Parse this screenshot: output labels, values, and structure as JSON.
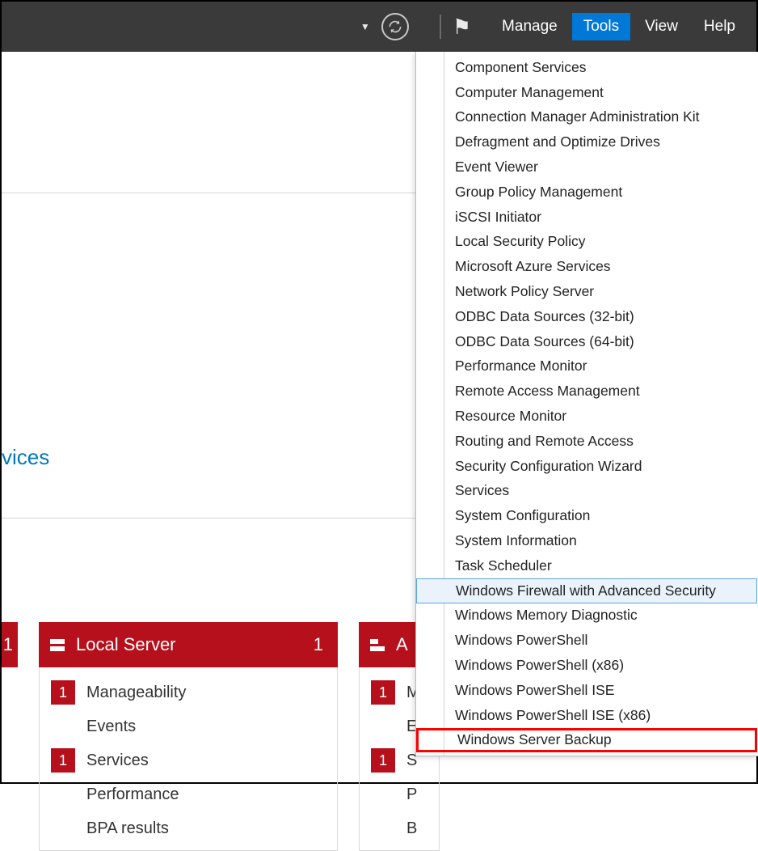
{
  "topbar": {
    "manage": "Manage",
    "tools": "Tools",
    "view": "View",
    "help": "Help"
  },
  "partial_link": "vices",
  "tile0": {
    "count": "1"
  },
  "tile1": {
    "title": "Local Server",
    "count": "1",
    "rows": [
      {
        "badge": "1",
        "label": "Manageability"
      },
      {
        "badge": "",
        "label": "Events"
      },
      {
        "badge": "1",
        "label": "Services"
      },
      {
        "badge": "",
        "label": "Performance"
      },
      {
        "badge": "",
        "label": "BPA results"
      }
    ]
  },
  "tile2": {
    "title_fragment": "A",
    "rows": [
      {
        "badge": "1",
        "label": "M"
      },
      {
        "badge": "",
        "label": "E"
      },
      {
        "badge": "1",
        "label": "S"
      },
      {
        "badge": "",
        "label": "P"
      },
      {
        "badge": "",
        "label": "B"
      }
    ]
  },
  "tools_menu": {
    "items": [
      "Component Services",
      "Computer Management",
      "Connection Manager Administration Kit",
      "Defragment and Optimize Drives",
      "Event Viewer",
      "Group Policy Management",
      "iSCSI Initiator",
      "Local Security Policy",
      "Microsoft Azure Services",
      "Network Policy Server",
      "ODBC Data Sources (32-bit)",
      "ODBC Data Sources (64-bit)",
      "Performance Monitor",
      "Remote Access Management",
      "Resource Monitor",
      "Routing and Remote Access",
      "Security Configuration Wizard",
      "Services",
      "System Configuration",
      "System Information",
      "Task Scheduler",
      "Windows Firewall with Advanced Security",
      "Windows Memory Diagnostic",
      "Windows PowerShell",
      "Windows PowerShell (x86)",
      "Windows PowerShell ISE",
      "Windows PowerShell ISE (x86)",
      "Windows Server Backup"
    ],
    "hover_index": 21,
    "highlight_index": 27
  }
}
